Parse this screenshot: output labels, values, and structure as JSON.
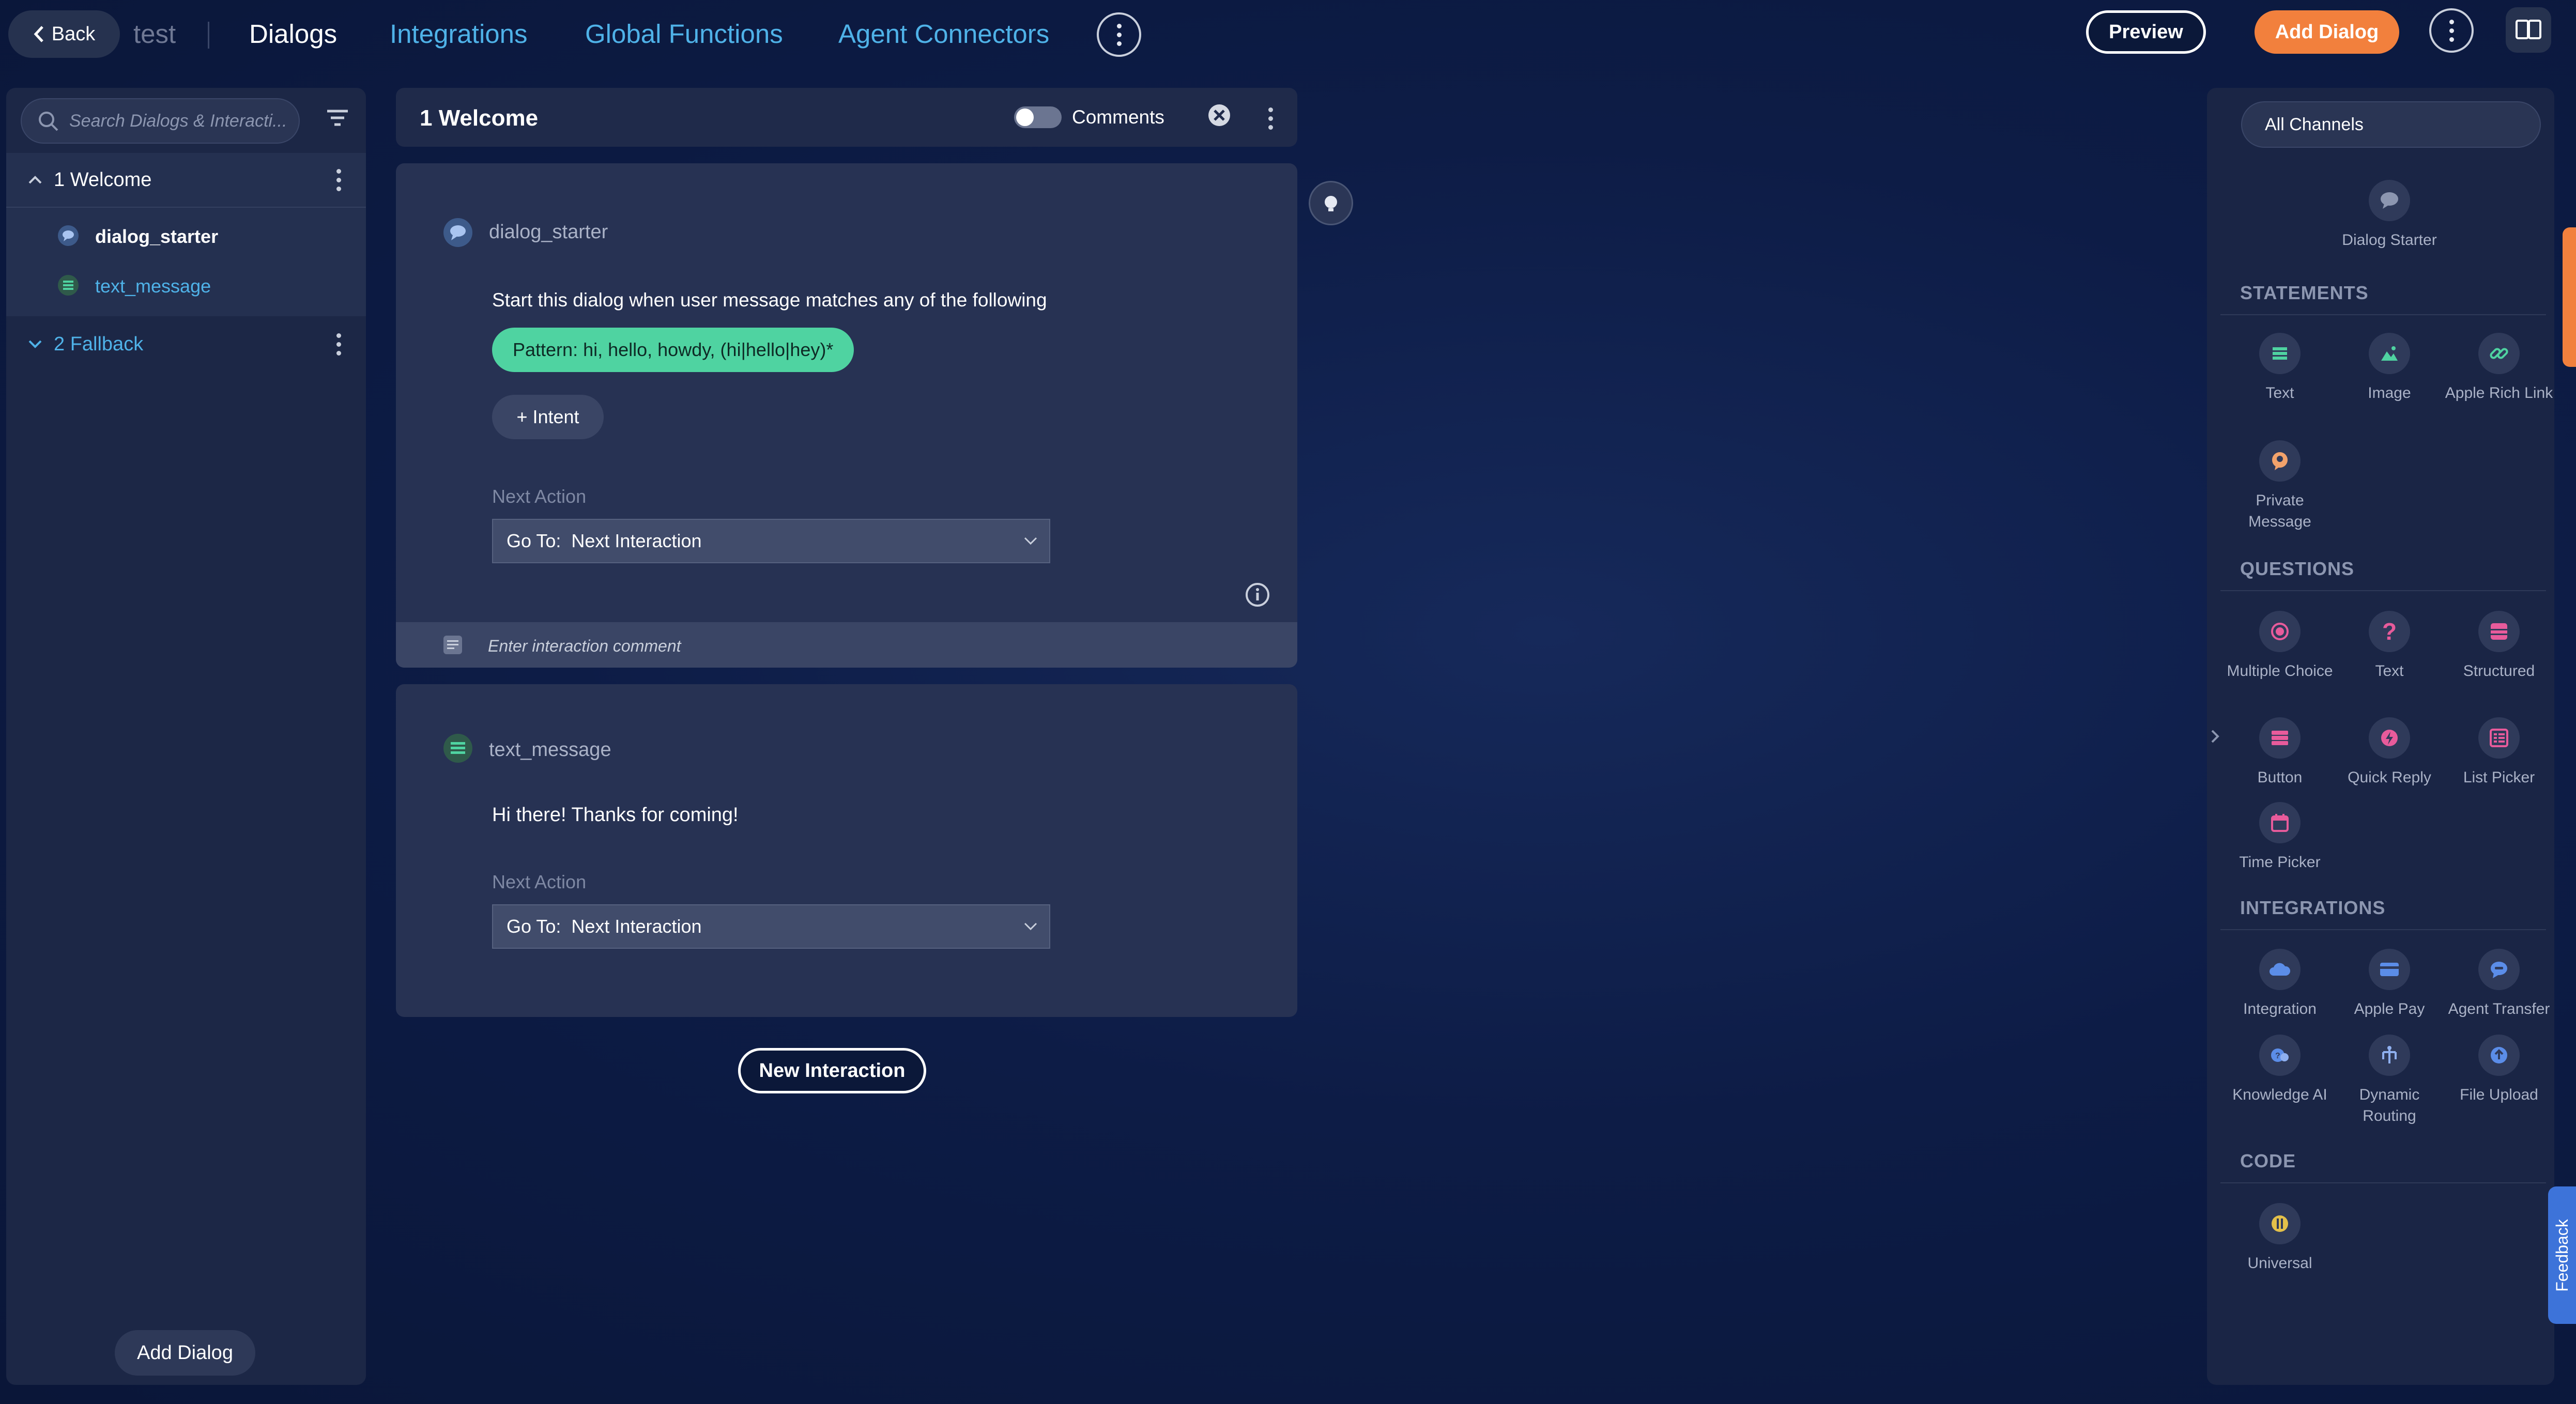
{
  "topbar": {
    "back_label": "Back",
    "bot_name": "test",
    "tabs": [
      "Dialogs",
      "Integrations",
      "Global Functions",
      "Agent Connectors"
    ],
    "preview_label": "Preview",
    "add_dialog_label": "Add Dialog"
  },
  "sidebar": {
    "search_placeholder": "Search Dialogs & Interacti...",
    "dialogs": [
      {
        "label": "1 Welcome",
        "interactions": [
          "dialog_starter",
          "text_message"
        ]
      },
      {
        "label": "2 Fallback"
      }
    ],
    "add_dialog_label": "Add Dialog"
  },
  "editor": {
    "title": "1 Welcome",
    "comments_label": "Comments",
    "starter": {
      "name": "dialog_starter",
      "description": "Start this dialog when user message matches any of the following",
      "pattern": "Pattern:  hi, hello, howdy, (hi|hello|hey)*",
      "intent_label": "+ Intent",
      "next_action_label": "Next Action",
      "goto_label": "Go To:",
      "goto_value": "Next Interaction",
      "comment_placeholder": "Enter interaction comment"
    },
    "text_message": {
      "name": "text_message",
      "message": "Hi there! Thanks for coming!",
      "next_action_label": "Next Action",
      "goto_label": "Go To:",
      "goto_value": "Next Interaction"
    },
    "new_interaction_label": "New Interaction"
  },
  "toolbox": {
    "channel": "All Channels",
    "dialog_starter_label": "Dialog Starter",
    "sections": {
      "statements": "STATEMENTS",
      "questions": "QUESTIONS",
      "integrations": "INTEGRATIONS",
      "code": "CODE"
    },
    "statements": [
      "Text",
      "Image",
      "Apple Rich Link",
      "Private Message"
    ],
    "questions": [
      "Multiple Choice",
      "Text",
      "Structured",
      "Button",
      "Quick Reply",
      "List Picker",
      "Time Picker"
    ],
    "integrations": [
      "Integration",
      "Apple Pay",
      "Agent Transfer",
      "Knowledge AI",
      "Dynamic Routing",
      "File Upload"
    ],
    "code": [
      "Universal"
    ],
    "feedback_label": "Feedback"
  },
  "colors": {
    "background": "#0d1c46",
    "accent_orange": "#f2803d",
    "accent_green": "#4fd3a1",
    "link_blue": "#4fb2e8",
    "statement_green": "#4fd3a1",
    "question_pink": "#e85b9b",
    "integration_blue": "#5b8de8",
    "code_gold": "#e3c04a"
  }
}
